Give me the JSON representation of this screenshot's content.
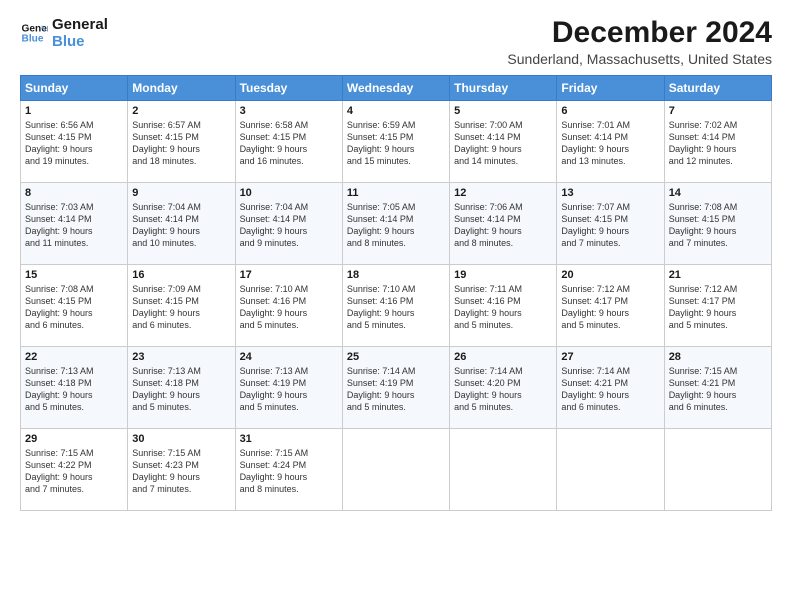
{
  "logo": {
    "line1": "General",
    "line2": "Blue"
  },
  "title": "December 2024",
  "subtitle": "Sunderland, Massachusetts, United States",
  "days_of_week": [
    "Sunday",
    "Monday",
    "Tuesday",
    "Wednesday",
    "Thursday",
    "Friday",
    "Saturday"
  ],
  "weeks": [
    [
      {
        "day": "1",
        "text": "Sunrise: 6:56 AM\nSunset: 4:15 PM\nDaylight: 9 hours\nand 19 minutes."
      },
      {
        "day": "2",
        "text": "Sunrise: 6:57 AM\nSunset: 4:15 PM\nDaylight: 9 hours\nand 18 minutes."
      },
      {
        "day": "3",
        "text": "Sunrise: 6:58 AM\nSunset: 4:15 PM\nDaylight: 9 hours\nand 16 minutes."
      },
      {
        "day": "4",
        "text": "Sunrise: 6:59 AM\nSunset: 4:15 PM\nDaylight: 9 hours\nand 15 minutes."
      },
      {
        "day": "5",
        "text": "Sunrise: 7:00 AM\nSunset: 4:14 PM\nDaylight: 9 hours\nand 14 minutes."
      },
      {
        "day": "6",
        "text": "Sunrise: 7:01 AM\nSunset: 4:14 PM\nDaylight: 9 hours\nand 13 minutes."
      },
      {
        "day": "7",
        "text": "Sunrise: 7:02 AM\nSunset: 4:14 PM\nDaylight: 9 hours\nand 12 minutes."
      }
    ],
    [
      {
        "day": "8",
        "text": "Sunrise: 7:03 AM\nSunset: 4:14 PM\nDaylight: 9 hours\nand 11 minutes."
      },
      {
        "day": "9",
        "text": "Sunrise: 7:04 AM\nSunset: 4:14 PM\nDaylight: 9 hours\nand 10 minutes."
      },
      {
        "day": "10",
        "text": "Sunrise: 7:04 AM\nSunset: 4:14 PM\nDaylight: 9 hours\nand 9 minutes."
      },
      {
        "day": "11",
        "text": "Sunrise: 7:05 AM\nSunset: 4:14 PM\nDaylight: 9 hours\nand 8 minutes."
      },
      {
        "day": "12",
        "text": "Sunrise: 7:06 AM\nSunset: 4:14 PM\nDaylight: 9 hours\nand 8 minutes."
      },
      {
        "day": "13",
        "text": "Sunrise: 7:07 AM\nSunset: 4:15 PM\nDaylight: 9 hours\nand 7 minutes."
      },
      {
        "day": "14",
        "text": "Sunrise: 7:08 AM\nSunset: 4:15 PM\nDaylight: 9 hours\nand 7 minutes."
      }
    ],
    [
      {
        "day": "15",
        "text": "Sunrise: 7:08 AM\nSunset: 4:15 PM\nDaylight: 9 hours\nand 6 minutes."
      },
      {
        "day": "16",
        "text": "Sunrise: 7:09 AM\nSunset: 4:15 PM\nDaylight: 9 hours\nand 6 minutes."
      },
      {
        "day": "17",
        "text": "Sunrise: 7:10 AM\nSunset: 4:16 PM\nDaylight: 9 hours\nand 5 minutes."
      },
      {
        "day": "18",
        "text": "Sunrise: 7:10 AM\nSunset: 4:16 PM\nDaylight: 9 hours\nand 5 minutes."
      },
      {
        "day": "19",
        "text": "Sunrise: 7:11 AM\nSunset: 4:16 PM\nDaylight: 9 hours\nand 5 minutes."
      },
      {
        "day": "20",
        "text": "Sunrise: 7:12 AM\nSunset: 4:17 PM\nDaylight: 9 hours\nand 5 minutes."
      },
      {
        "day": "21",
        "text": "Sunrise: 7:12 AM\nSunset: 4:17 PM\nDaylight: 9 hours\nand 5 minutes."
      }
    ],
    [
      {
        "day": "22",
        "text": "Sunrise: 7:13 AM\nSunset: 4:18 PM\nDaylight: 9 hours\nand 5 minutes."
      },
      {
        "day": "23",
        "text": "Sunrise: 7:13 AM\nSunset: 4:18 PM\nDaylight: 9 hours\nand 5 minutes."
      },
      {
        "day": "24",
        "text": "Sunrise: 7:13 AM\nSunset: 4:19 PM\nDaylight: 9 hours\nand 5 minutes."
      },
      {
        "day": "25",
        "text": "Sunrise: 7:14 AM\nSunset: 4:19 PM\nDaylight: 9 hours\nand 5 minutes."
      },
      {
        "day": "26",
        "text": "Sunrise: 7:14 AM\nSunset: 4:20 PM\nDaylight: 9 hours\nand 5 minutes."
      },
      {
        "day": "27",
        "text": "Sunrise: 7:14 AM\nSunset: 4:21 PM\nDaylight: 9 hours\nand 6 minutes."
      },
      {
        "day": "28",
        "text": "Sunrise: 7:15 AM\nSunset: 4:21 PM\nDaylight: 9 hours\nand 6 minutes."
      }
    ],
    [
      {
        "day": "29",
        "text": "Sunrise: 7:15 AM\nSunset: 4:22 PM\nDaylight: 9 hours\nand 7 minutes."
      },
      {
        "day": "30",
        "text": "Sunrise: 7:15 AM\nSunset: 4:23 PM\nDaylight: 9 hours\nand 7 minutes."
      },
      {
        "day": "31",
        "text": "Sunrise: 7:15 AM\nSunset: 4:24 PM\nDaylight: 9 hours\nand 8 minutes."
      },
      {
        "day": "",
        "text": ""
      },
      {
        "day": "",
        "text": ""
      },
      {
        "day": "",
        "text": ""
      },
      {
        "day": "",
        "text": ""
      }
    ]
  ]
}
